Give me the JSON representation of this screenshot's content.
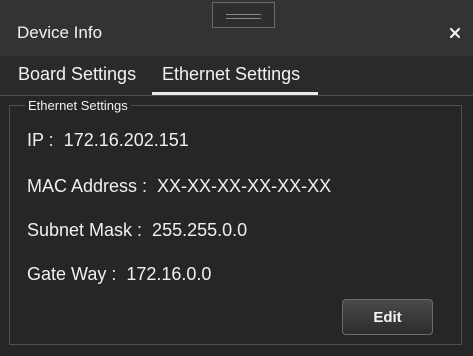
{
  "window": {
    "title": "Device Info"
  },
  "tabs": [
    {
      "label": "Board Settings",
      "active": false
    },
    {
      "label": "Ethernet Settings",
      "active": true
    }
  ],
  "ethernet": {
    "group_title": "Ethernet Settings",
    "ip_line": "IP :  172.16.202.151",
    "mac_line": "MAC Address :  XX-XX-XX-XX-XX-XX",
    "subnet_line": "Subnet Mask :  255.255.0.0",
    "gateway_line": "Gate Way :  172.16.0.0"
  },
  "buttons": {
    "edit_label": "Edit"
  },
  "icons": {
    "close": "close-icon",
    "drag": "drag-handle-icon"
  },
  "colors": {
    "background": "#262626",
    "titlebar": "#333333",
    "text": "#f0f0f0",
    "accent": "#e9e9e9"
  }
}
